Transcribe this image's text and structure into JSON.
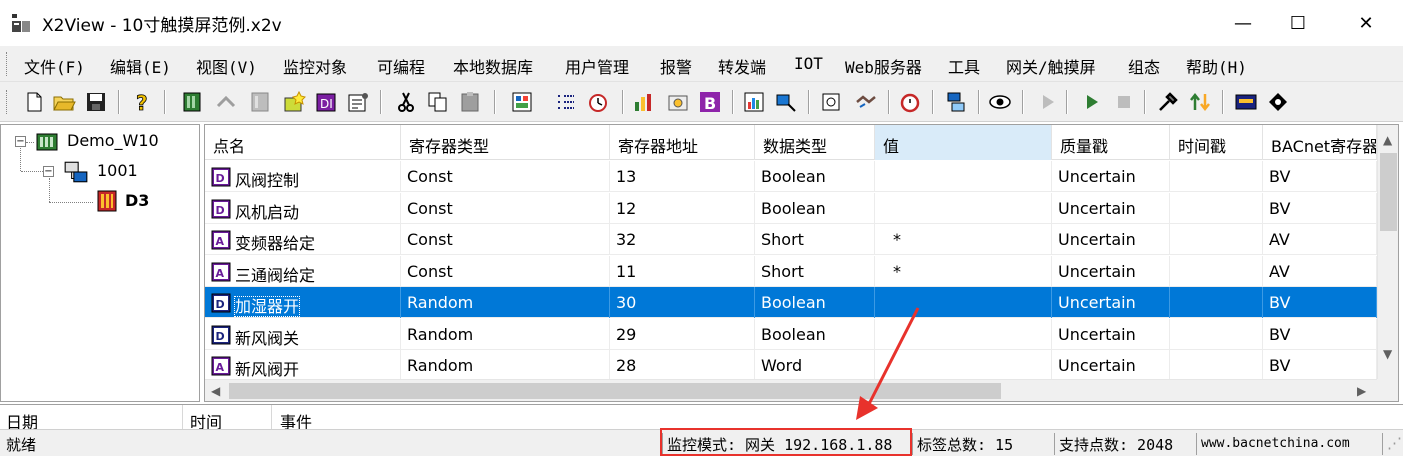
{
  "window": {
    "title": "X2View - 10寸触摸屏范例.x2v",
    "minimize": "—",
    "maximize": "☐",
    "close": "✕"
  },
  "menu": [
    "文件(F)",
    "编辑(E)",
    "视图(V)",
    "监控对象",
    "可编程",
    "本地数据库",
    "用户管理",
    "报警",
    "转发端",
    "IOT",
    "Web服务器",
    "工具",
    "网关/触摸屏",
    "组态",
    "帮助(H)"
  ],
  "toolbar_icons": [
    "new-file-icon",
    "open-folder-icon",
    "save-icon",
    "help-icon",
    "device-icon",
    "connect-icon",
    "disabled-device-icon",
    "new-tag-icon",
    "digital-tag-icon",
    "properties-icon",
    "cut-icon",
    "copy-icon",
    "paste-icon",
    "monitor-icon",
    "list-icon",
    "clock-icon",
    "trend-icon",
    "tag-edit-icon",
    "bacnet-icon",
    "chart-icon",
    "network-icon",
    "report-icon",
    "handshake-icon",
    "alarm-clock-icon",
    "server-icon",
    "view-icon",
    "play-disabled-icon",
    "play-icon",
    "stop-icon",
    "tools-icon",
    "transfer-icon",
    "screen-icon",
    "script-icon"
  ],
  "tree": {
    "root": "Demo_W10",
    "gateway": "1001",
    "device": "D3"
  },
  "grid": {
    "columns": [
      "点名",
      "寄存器类型",
      "寄存器地址",
      "数据类型",
      "值",
      "质量戳",
      "时间戳",
      "BACnet寄存器"
    ],
    "rows": [
      {
        "type": "DI",
        "name": "风阀控制",
        "reg_type": "Const",
        "address": "13",
        "data_type": "Boolean",
        "value": "",
        "quality": "Uncertain",
        "time": "",
        "bacnet": "BV"
      },
      {
        "type": "DI",
        "name": "风机启动",
        "reg_type": "Const",
        "address": "12",
        "data_type": "Boolean",
        "value": "",
        "quality": "Uncertain",
        "time": "",
        "bacnet": "BV"
      },
      {
        "type": "AI",
        "name": "变频器给定",
        "reg_type": "Const",
        "address": "32",
        "data_type": "Short",
        "value": "*",
        "quality": "Uncertain",
        "time": "",
        "bacnet": "AV"
      },
      {
        "type": "AI",
        "name": "三通阀给定",
        "reg_type": "Const",
        "address": "11",
        "data_type": "Short",
        "value": "*",
        "quality": "Uncertain",
        "time": "",
        "bacnet": "AV"
      },
      {
        "type": "DI",
        "name": "加湿器开",
        "reg_type": "Random",
        "address": "30",
        "data_type": "Boolean",
        "value": "",
        "quality": "Uncertain",
        "time": "",
        "bacnet": "BV",
        "selected": true
      },
      {
        "type": "DI",
        "name": "新风阀关",
        "reg_type": "Random",
        "address": "29",
        "data_type": "Boolean",
        "value": "",
        "quality": "Uncertain",
        "time": "",
        "bacnet": "BV"
      },
      {
        "type": "AI",
        "name": "新风阀开",
        "reg_type": "Random",
        "address": "28",
        "data_type": "Word",
        "value": "",
        "quality": "Uncertain",
        "time": "",
        "bacnet": "BV"
      }
    ]
  },
  "events": {
    "columns": [
      "日期",
      "时间",
      "事件"
    ]
  },
  "status": {
    "ready": "就绪",
    "mode": "监控模式: 网关 192.168.1.88",
    "tag_count": "标签总数: 15",
    "support_points": "支持点数: 2048",
    "website": "www.bacnetchina.com"
  },
  "colors": {
    "selection": "#0078d7",
    "header_selected": "#d9ebf9",
    "highlight": "#e8322c"
  }
}
